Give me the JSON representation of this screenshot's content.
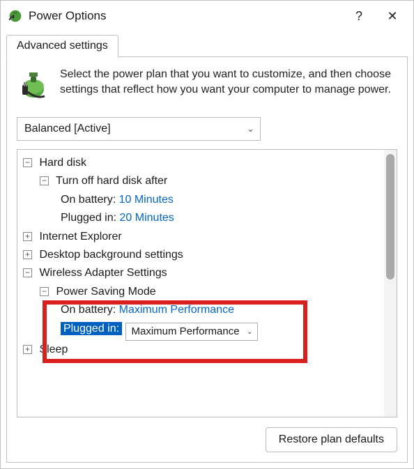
{
  "window": {
    "title": "Power Options",
    "help_glyph": "?",
    "close_glyph": "✕"
  },
  "tab": {
    "label": "Advanced settings"
  },
  "intro": {
    "text": "Select the power plan that you want to customize, and then choose settings that reflect how you want your computer to manage power."
  },
  "plan": {
    "selected": "Balanced [Active]"
  },
  "tree": {
    "hard_disk": {
      "label": "Hard disk",
      "expanded": true,
      "turn_off": {
        "label": "Turn off hard disk after",
        "expanded": true,
        "on_battery_label": "On battery:",
        "on_battery_value": "10 Minutes",
        "plugged_in_label": "Plugged in:",
        "plugged_in_value": "20 Minutes"
      }
    },
    "ie": {
      "label": "Internet Explorer",
      "expanded": false
    },
    "desktop_bg": {
      "label": "Desktop background settings",
      "expanded": false
    },
    "wireless": {
      "label": "Wireless Adapter Settings",
      "expanded": true,
      "psm": {
        "label": "Power Saving Mode",
        "expanded": true,
        "on_battery_label": "On battery:",
        "on_battery_value": "Maximum Performance",
        "plugged_in_label": "Plugged in:",
        "plugged_in_value": "Maximum Performance"
      }
    },
    "sleep": {
      "label": "Sleep",
      "expanded": false
    }
  },
  "buttons": {
    "restore": "Restore plan defaults"
  },
  "glyphs": {
    "plus": "+",
    "minus": "−",
    "chevron_down": "⌄"
  }
}
